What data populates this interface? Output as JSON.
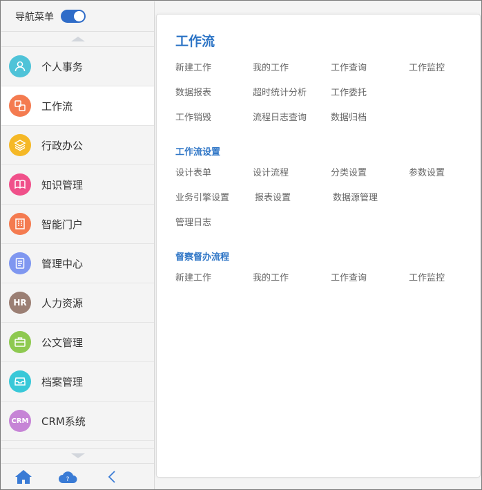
{
  "sidebar": {
    "header_title": "导航菜单",
    "toggle_on": true,
    "items": [
      {
        "label": "个人事务",
        "icon": "user-icon",
        "color": "#4fc3d8",
        "active": false
      },
      {
        "label": "工作流",
        "icon": "workflow-icon",
        "color": "#f47b50",
        "active": true
      },
      {
        "label": "行政办公",
        "icon": "layers-icon",
        "color": "#f5b826",
        "active": false
      },
      {
        "label": "知识管理",
        "icon": "book-icon",
        "color": "#f0508a",
        "active": false
      },
      {
        "label": "智能门户",
        "icon": "building-icon",
        "color": "#f47b50",
        "active": false
      },
      {
        "label": "管理中心",
        "icon": "document-icon",
        "color": "#7f97f0",
        "active": false
      },
      {
        "label": "人力资源",
        "icon": "hr-icon",
        "color": "#9b7f74",
        "active": false,
        "glyph": "HR"
      },
      {
        "label": "公文管理",
        "icon": "briefcase-icon",
        "color": "#8ec950",
        "active": false
      },
      {
        "label": "档案管理",
        "icon": "archive-icon",
        "color": "#38c8d8",
        "active": false
      },
      {
        "label": "CRM系统",
        "icon": "crm-icon",
        "color": "#c684d6",
        "active": false,
        "glyph": "CRM"
      }
    ],
    "bottom": [
      "home-icon",
      "cloud-help-icon",
      "collapse-left-icon"
    ]
  },
  "content": {
    "title": "工作流",
    "links": [
      "新建工作",
      "我的工作",
      "工作查询",
      "工作监控",
      "数据报表",
      "超时统计分析",
      "工作委托",
      "工作销毁",
      "流程日志查询",
      "数据归档"
    ],
    "sections": [
      {
        "title": "工作流设置",
        "links": [
          "设计表单",
          "设计流程",
          "分类设置",
          "参数设置",
          "业务引擎设置",
          "报表设置",
          "数据源管理",
          "管理日志"
        ]
      },
      {
        "title": "督察督办流程",
        "links": [
          "新建工作",
          "我的工作",
          "工作查询",
          "工作监控"
        ]
      }
    ]
  },
  "colors": {
    "accent": "#2e75c6",
    "toggle": "#2f6cc8",
    "bottom_icons": "#3a7bd5"
  }
}
